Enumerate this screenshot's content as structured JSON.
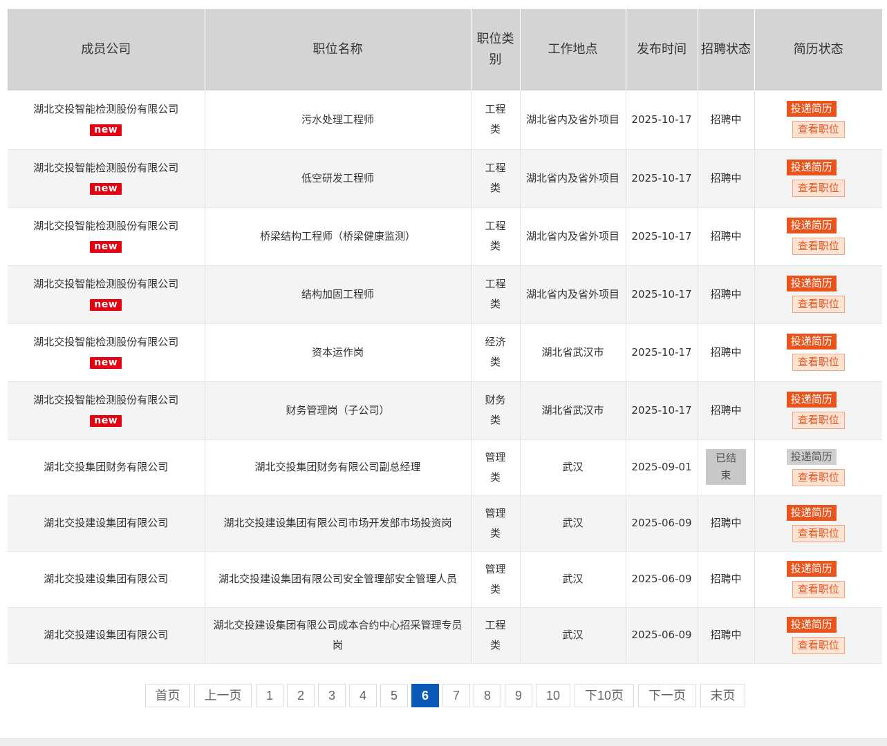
{
  "header": {
    "company": "成员公司",
    "position": "职位名称",
    "category": "职位类别",
    "location": "工作地点",
    "published": "发布时间",
    "recruit_status": "招聘状态",
    "resume_status": "简历状态"
  },
  "rows": [
    {
      "company": "湖北交投智能检测股份有限公司",
      "is_new": true,
      "new_label": "new",
      "position": "污水处理工程师",
      "category": "工程类",
      "location": "湖北省内及省外项目",
      "date": "2025-10-17",
      "status": "招聘中",
      "ended": false,
      "apply_label": "投递简历",
      "view_label": "查看职位"
    },
    {
      "company": "湖北交投智能检测股份有限公司",
      "is_new": true,
      "new_label": "new",
      "position": "低空研发工程师",
      "category": "工程类",
      "location": "湖北省内及省外项目",
      "date": "2025-10-17",
      "status": "招聘中",
      "ended": false,
      "apply_label": "投递简历",
      "view_label": "查看职位"
    },
    {
      "company": "湖北交投智能检测股份有限公司",
      "is_new": true,
      "new_label": "new",
      "position": "桥梁结构工程师（桥梁健康监测）",
      "category": "工程类",
      "location": "湖北省内及省外项目",
      "date": "2025-10-17",
      "status": "招聘中",
      "ended": false,
      "apply_label": "投递简历",
      "view_label": "查看职位"
    },
    {
      "company": "湖北交投智能检测股份有限公司",
      "is_new": true,
      "new_label": "new",
      "position": "结构加固工程师",
      "category": "工程类",
      "location": "湖北省内及省外项目",
      "date": "2025-10-17",
      "status": "招聘中",
      "ended": false,
      "apply_label": "投递简历",
      "view_label": "查看职位"
    },
    {
      "company": "湖北交投智能检测股份有限公司",
      "is_new": true,
      "new_label": "new",
      "position": "资本运作岗",
      "category": "经济类",
      "location": "湖北省武汉市",
      "date": "2025-10-17",
      "status": "招聘中",
      "ended": false,
      "apply_label": "投递简历",
      "view_label": "查看职位"
    },
    {
      "company": "湖北交投智能检测股份有限公司",
      "is_new": true,
      "new_label": "new",
      "position": "财务管理岗（子公司）",
      "category": "财务类",
      "location": "湖北省武汉市",
      "date": "2025-10-17",
      "status": "招聘中",
      "ended": false,
      "apply_label": "投递简历",
      "view_label": "查看职位"
    },
    {
      "company": "湖北交投集团财务有限公司",
      "is_new": false,
      "new_label": "",
      "position": "湖北交投集团财务有限公司副总经理",
      "category": "管理类",
      "location": "武汉",
      "date": "2025-09-01",
      "status": "已结束",
      "ended": true,
      "apply_label": "投递简历",
      "view_label": "查看职位"
    },
    {
      "company": "湖北交投建设集团有限公司",
      "is_new": false,
      "new_label": "",
      "position": "湖北交投建设集团有限公司市场开发部市场投资岗",
      "category": "管理类",
      "location": "武汉",
      "date": "2025-06-09",
      "status": "招聘中",
      "ended": false,
      "apply_label": "投递简历",
      "view_label": "查看职位"
    },
    {
      "company": "湖北交投建设集团有限公司",
      "is_new": false,
      "new_label": "",
      "position": "湖北交投建设集团有限公司安全管理部安全管理人员",
      "category": "管理类",
      "location": "武汉",
      "date": "2025-06-09",
      "status": "招聘中",
      "ended": false,
      "apply_label": "投递简历",
      "view_label": "查看职位"
    },
    {
      "company": "湖北交投建设集团有限公司",
      "is_new": false,
      "new_label": "",
      "position": "湖北交投建设集团有限公司成本合约中心招采管理专员岗",
      "category": "工程类",
      "location": "武汉",
      "date": "2025-06-09",
      "status": "招聘中",
      "ended": false,
      "apply_label": "投递简历",
      "view_label": "查看职位"
    }
  ],
  "pagination": {
    "first": "首页",
    "prev": "上一页",
    "pages": [
      "1",
      "2",
      "3",
      "4",
      "5",
      "6",
      "7",
      "8",
      "9",
      "10"
    ],
    "current": "6",
    "next10": "下10页",
    "next": "下一页",
    "last": "末页"
  },
  "colors": {
    "header_bg": "#d4d4d4",
    "new_badge": "#e60012",
    "apply_btn": "#e8541c",
    "view_btn_bg": "#fde3d3",
    "pager_active": "#0a58b8"
  }
}
